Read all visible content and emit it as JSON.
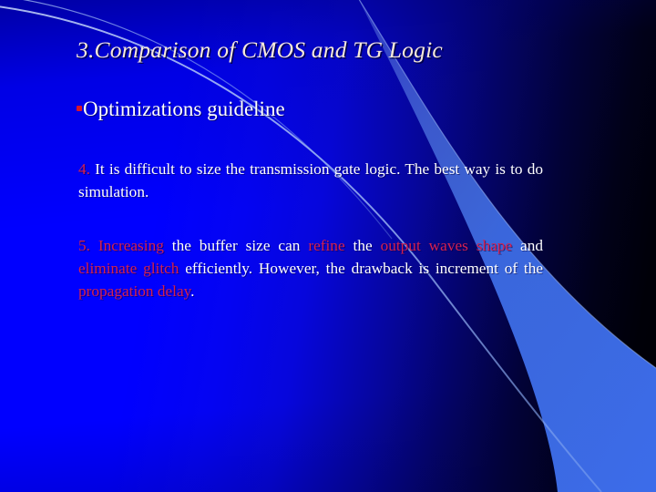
{
  "slide": {
    "title": "3.Comparison of CMOS and TG Logic",
    "bullet": {
      "marker": "square-bullet-icon",
      "text": "Optimizations guideline"
    },
    "paragraphs": [
      {
        "id": "para-4",
        "number": "4.",
        "number_color": "#D42050",
        "runs": [
          {
            "text": "4.",
            "color": "#D42050"
          },
          {
            "text": " It is difficult to size the transmission gate logic. The best way is to do simulation.",
            "color": "#FFFFFF"
          }
        ],
        "plain": "4. It is difficult to size the transmission gate logic. The best way is to do simulation."
      },
      {
        "id": "para-5",
        "number": "5.",
        "number_color": "#D42050",
        "runs": [
          {
            "text": "5. Increasing",
            "color": "#D42050"
          },
          {
            "text": " the buffer size can ",
            "color": "#FFFFFF"
          },
          {
            "text": "refine",
            "color": "#D42050"
          },
          {
            "text": " the ",
            "color": "#FFFFFF"
          },
          {
            "text": "output waves shape",
            "color": "#D42050"
          },
          {
            "text": " and ",
            "color": "#FFFFFF"
          },
          {
            "text": "eliminate glitch",
            "color": "#D42050"
          },
          {
            "text": " efficiently. However, the drawback is increment of the ",
            "color": "#FFFFFF"
          },
          {
            "text": "propagation delay",
            "color": "#D42050"
          },
          {
            "text": ".",
            "color": "#FFFFFF"
          }
        ],
        "plain": "5. Increasing the buffer size can refine the output waves shape and eliminate glitch efficiently. However, the drawback is increment of the propagation delay."
      }
    ],
    "fragments": {
      "p4_num": "4.",
      "p4_body": " It is difficult to size the transmission gate logic. The best way is to do simulation.",
      "p5_num_inc": "5. Increasing",
      "p5_t1": " the buffer size can ",
      "p5_refine": "refine",
      "p5_t2": " the ",
      "p5_output": "output waves shape",
      "p5_t3": " and ",
      "p5_elim": "eliminate glitch",
      "p5_t4": " efficiently. However, the drawback is increment of the ",
      "p5_prop": "propagation delay",
      "p5_t5": "."
    },
    "colors": {
      "background_left": "#0000FF",
      "background_right": "#000008",
      "swoosh": "#3F6FE8",
      "swoosh_line": "#8FB0F2",
      "title_text": "#F7E9DA",
      "body_text": "#FFFFFF",
      "accent_red": "#D42050",
      "bullet_red": "#D9152B"
    },
    "decorations": [
      {
        "name": "thin-arc-line",
        "description": "thin light blue arc from top-left to center-right"
      },
      {
        "name": "swoosh-crescent",
        "description": "bright blue crescent sweeping from upper-middle to bottom-right"
      }
    ]
  }
}
